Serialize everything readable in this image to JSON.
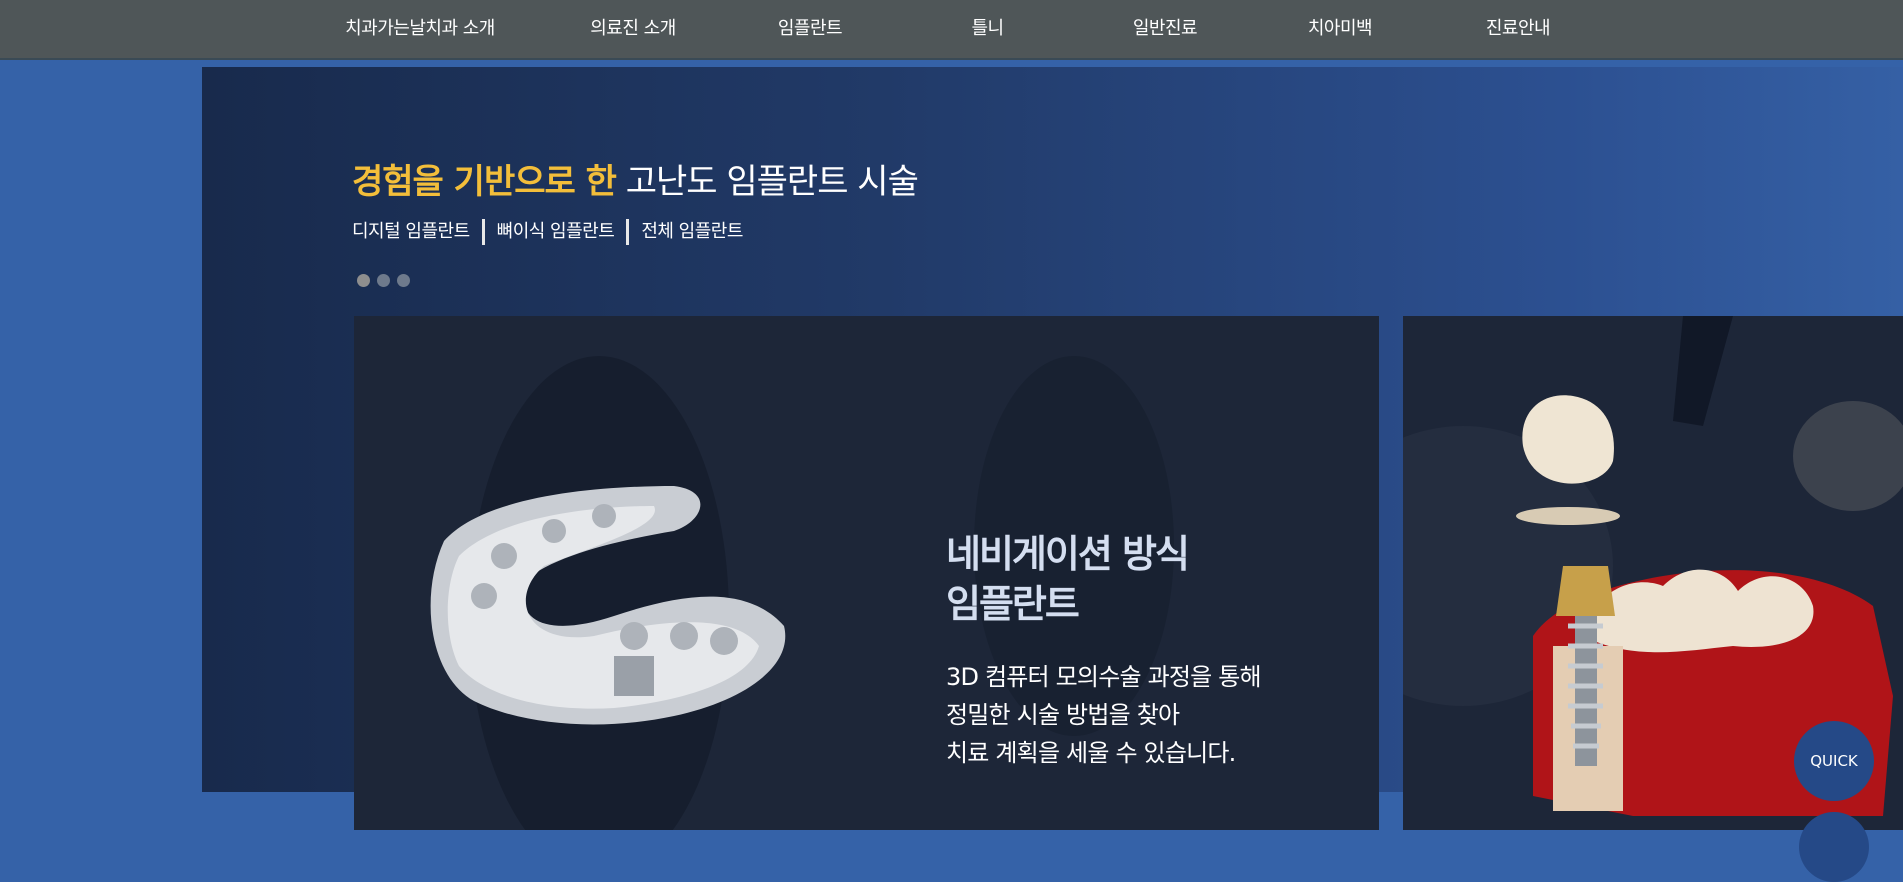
{
  "nav": {
    "items": [
      {
        "label": "치과가는날치과 소개"
      },
      {
        "label": "의료진 소개"
      },
      {
        "label": "임플란트"
      },
      {
        "label": "틀니"
      },
      {
        "label": "일반진료"
      },
      {
        "label": "치아미백"
      },
      {
        "label": "진료안내"
      }
    ]
  },
  "hero": {
    "headline_highlight": "경험을 기반으로 한",
    "headline_rest": " 고난도 임플란트 시술",
    "tabs": [
      {
        "label": "디지털 임플란트"
      },
      {
        "label": "뼈이식 임플란트"
      },
      {
        "label": "전체 임플란트"
      }
    ],
    "colors": {
      "highlight": "#f3be3a",
      "accent": "#3562a8"
    }
  },
  "slide1": {
    "title_line1": "네비게이션 방식",
    "title_line2": "임플란트",
    "desc_line1": "3D 컴퓨터 모의수술 과정을 통해",
    "desc_line2": "정밀한 시술 방법을 찾아",
    "desc_line3": "치료 계획을 세울 수 있습니다."
  },
  "quick": {
    "label": "QUICK"
  }
}
